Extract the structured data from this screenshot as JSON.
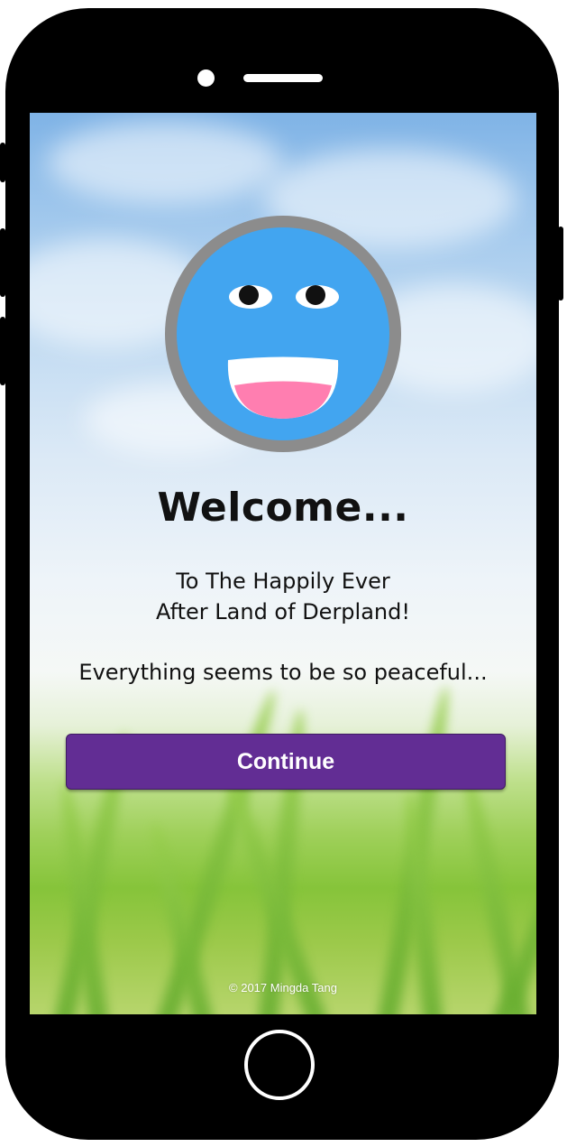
{
  "screen": {
    "title": "Welcome...",
    "subtitle_line1": "To The Happily Ever",
    "subtitle_line2": "After Land of Derpland!",
    "tagline": "Everything seems to be so peaceful...",
    "continue_label": "Continue",
    "copyright": "© 2017 Mingda Tang"
  },
  "colors": {
    "button_background": "#622d94",
    "avatar_face": "#42a5f0",
    "avatar_ring": "#8c8c8c",
    "mouth_tongue": "#ff7eb0",
    "device_body": "#000000"
  },
  "icons": {
    "avatar": "happy-face-icon",
    "home": "home-button-icon"
  }
}
